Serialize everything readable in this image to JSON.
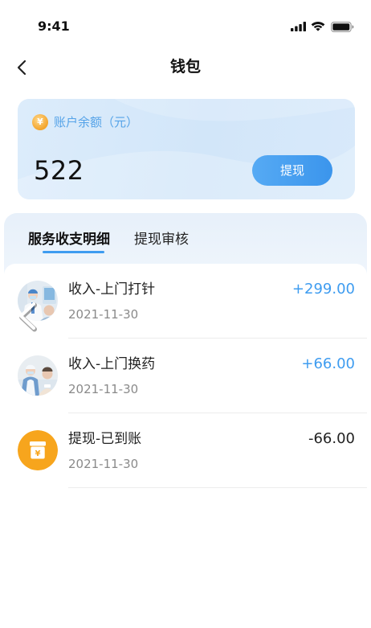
{
  "status_bar": {
    "time": "9:41",
    "icons": [
      "signal-icon",
      "wifi-icon",
      "battery-icon"
    ]
  },
  "nav": {
    "title": "钱包",
    "back_icon": "chevron-left-icon"
  },
  "balance": {
    "label": "账户余额（元）",
    "amount": "522",
    "withdraw_label": "提现",
    "coin_icon": "coin-icon"
  },
  "currency_symbol": "¥",
  "tabs": [
    {
      "label": "服务收支明细",
      "active": true
    },
    {
      "label": "提现审核",
      "active": false
    }
  ],
  "transactions": [
    {
      "title": "收入-上门打针",
      "date": "2021-11-30",
      "amount": "+299.00",
      "type": "income",
      "icon": "avatar-injection"
    },
    {
      "title": "收入-上门换药",
      "date": "2021-11-30",
      "amount": "+66.00",
      "type": "income",
      "icon": "avatar-dressing"
    },
    {
      "title": "提现-已到账",
      "date": "2021-11-30",
      "amount": "-66.00",
      "type": "withdrawal",
      "icon": "withdraw-icon"
    }
  ],
  "overlay": {
    "icon": "prev-arrow-icon"
  },
  "colors": {
    "accent": "#3e9cf0",
    "income_amount": "#3e9cf0",
    "withdrawal_amount": "#222222",
    "withdraw_icon_bg": "#f7a51d",
    "coin": "#f3a42c"
  }
}
